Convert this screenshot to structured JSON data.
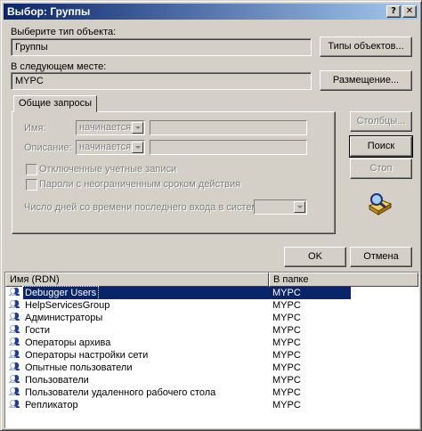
{
  "window": {
    "title": "Выбор: Группы",
    "help_label": "?",
    "close_label": "✕"
  },
  "object_type": {
    "label": "Выберите тип объекта:",
    "value": "Группы",
    "button_label": "Типы объектов..."
  },
  "location": {
    "label": "В следующем месте:",
    "value": "MYPC",
    "button_label": "Размещение..."
  },
  "common_queries": {
    "tab_label": "Общие запросы",
    "name_label": "Имя:",
    "name_mode": "начинается",
    "description_label": "Описание:",
    "description_mode": "начинается",
    "disabled_accounts_label": "Отключенные учетные записи",
    "non_expiring_label": "Пароли с неограниченным сроком действия",
    "days_since_login_label": "Число дней со времени последнего входа в систему:"
  },
  "side_buttons": {
    "columns_label": "Столбцы...",
    "search_label": "Поиск",
    "stop_label": "Стоп"
  },
  "icons": {
    "search_illustration": "find-icon",
    "group_icon": "group-icon"
  },
  "footer": {
    "ok_label": "OK",
    "cancel_label": "Отмена"
  },
  "results": {
    "columns": [
      "Имя (RDN)",
      "В папке"
    ],
    "rows": [
      {
        "name": "Debugger Users",
        "folder": "MYPC",
        "selected": true
      },
      {
        "name": "HelpServicesGroup",
        "folder": "MYPC"
      },
      {
        "name": "Администраторы",
        "folder": "MYPC"
      },
      {
        "name": "Гости",
        "folder": "MYPC"
      },
      {
        "name": "Операторы архива",
        "folder": "MYPC"
      },
      {
        "name": "Операторы настройки сети",
        "folder": "MYPC"
      },
      {
        "name": "Опытные пользователи",
        "folder": "MYPC"
      },
      {
        "name": "Пользователи",
        "folder": "MYPC"
      },
      {
        "name": "Пользователи удаленного рабочего стола",
        "folder": "MYPC"
      },
      {
        "name": "Репликатор",
        "folder": "MYPC"
      }
    ]
  },
  "colors": {
    "dialog_face": "#d4d0c8",
    "title_start": "#0a246a",
    "title_end": "#a6caf0",
    "selection": "#0a246a"
  }
}
